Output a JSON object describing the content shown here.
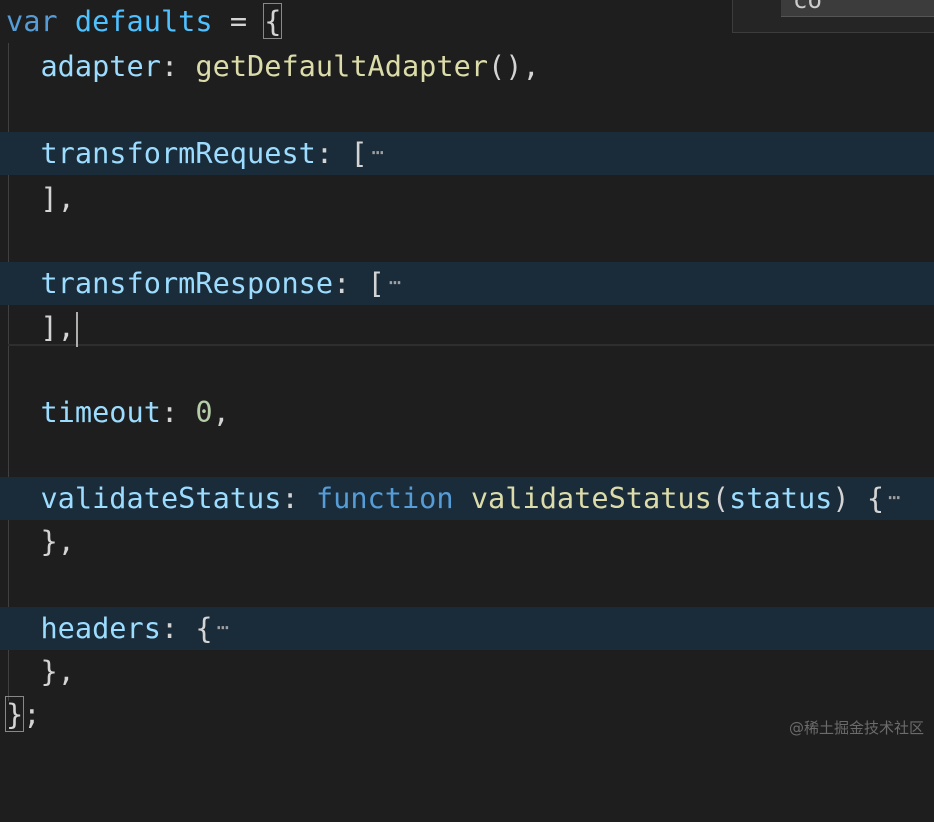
{
  "find_widget": {
    "query": "co"
  },
  "code": {
    "line1": {
      "kw": "var",
      "name": "defaults",
      "op": "=",
      "brace": "{"
    },
    "adapter": {
      "key": "adapter",
      "colon": ":",
      "fn": "getDefaultAdapter",
      "rest": "(),"
    },
    "transformRequest": {
      "key": "transformRequest",
      "colon": ":",
      "open": "[",
      "close": "],"
    },
    "transformResponse": {
      "key": "transformResponse",
      "colon": ":",
      "open": "[",
      "close": "],"
    },
    "timeout": {
      "key": "timeout",
      "colon": ":",
      "value": "0",
      "comma": ","
    },
    "validateStatus": {
      "key": "validateStatus",
      "colon": ":",
      "kw": "function",
      "fn": "validateStatus",
      "paren_open": "(",
      "param": "status",
      "paren_close": ")",
      "brace": "{",
      "close": "},"
    },
    "headers": {
      "key": "headers",
      "colon": ":",
      "open": "{",
      "close": "},"
    },
    "end": {
      "close": "}",
      "semi": ";"
    },
    "fold_marker": "⋯"
  },
  "watermark": "@稀土掘金技术社区",
  "colors": {
    "background": "#1e1e1e",
    "keyword": "#569cd6",
    "property": "#9cdcfe",
    "function": "#dcdcaa",
    "number": "#b5cea8",
    "folded_line_highlight": "#1a2b3a"
  }
}
